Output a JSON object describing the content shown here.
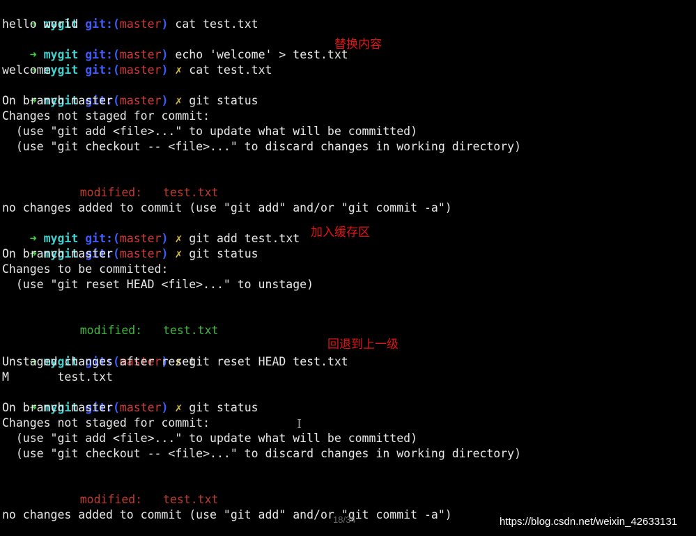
{
  "prompt": {
    "arrow": "➜",
    "dir": "mygit",
    "git_open": "git:(",
    "branch": "master",
    "git_close": ")",
    "dirty": "✗"
  },
  "lines": {
    "l1_cmd": "cat test.txt",
    "l2": "hello world",
    "l3_cmd": "echo 'welcome' > test.txt",
    "l4_cmd": "cat test.txt",
    "l5": "welcome",
    "l6_cmd": "git status",
    "l7": "On branch master",
    "l8": "Changes not staged for commit:",
    "l9": "  (use \"git add <file>...\" to update what will be committed)",
    "l10": "  (use \"git checkout -- <file>...\" to discard changes in working directory)",
    "l11_label": "modified:",
    "l11_file": "test.txt",
    "l12": "no changes added to commit (use \"git add\" and/or \"git commit -a\")",
    "l13_cmd": "git add test.txt",
    "l14_cmd": "git status",
    "l15": "On branch master",
    "l16": "Changes to be committed:",
    "l17": "  (use \"git reset HEAD <file>...\" to unstage)",
    "l18_label": "modified:",
    "l18_file": "test.txt",
    "l19_cmd": "git reset HEAD test.txt",
    "l20": "Unstaged changes after reset:",
    "l21": "M       test.txt",
    "l22_cmd": "git status",
    "l23": "On branch master",
    "l24": "Changes not staged for commit:",
    "l25": "  (use \"git add <file>...\" to update what will be committed)",
    "l26": "  (use \"git checkout -- <file>...\" to discard changes in working directory)",
    "l27_label": "modified:",
    "l27_file": "test.txt",
    "l28": "no changes added to commit (use \"git add\" and/or \"git commit -a\")"
  },
  "annotations": {
    "replace_content": "替换内容",
    "add_to_stage": "加入缓存区",
    "rollback": "回退到上一级"
  },
  "overlay": {
    "page_indicator": "18/34",
    "watermark": "https://blog.csdn.net/weixin_42633131",
    "cursor_glyph": "I"
  },
  "colors": {
    "background": "#000000",
    "text": "#e8e8e8",
    "arrow": "#3fd43f",
    "dir": "#3fd0d0",
    "git": "#3f5cff",
    "branch": "#d23a3a",
    "dirty": "#d8c23a",
    "modified_unstaged": "#c0392b",
    "modified_staged": "#3fb83f",
    "annotation": "#e01414"
  }
}
